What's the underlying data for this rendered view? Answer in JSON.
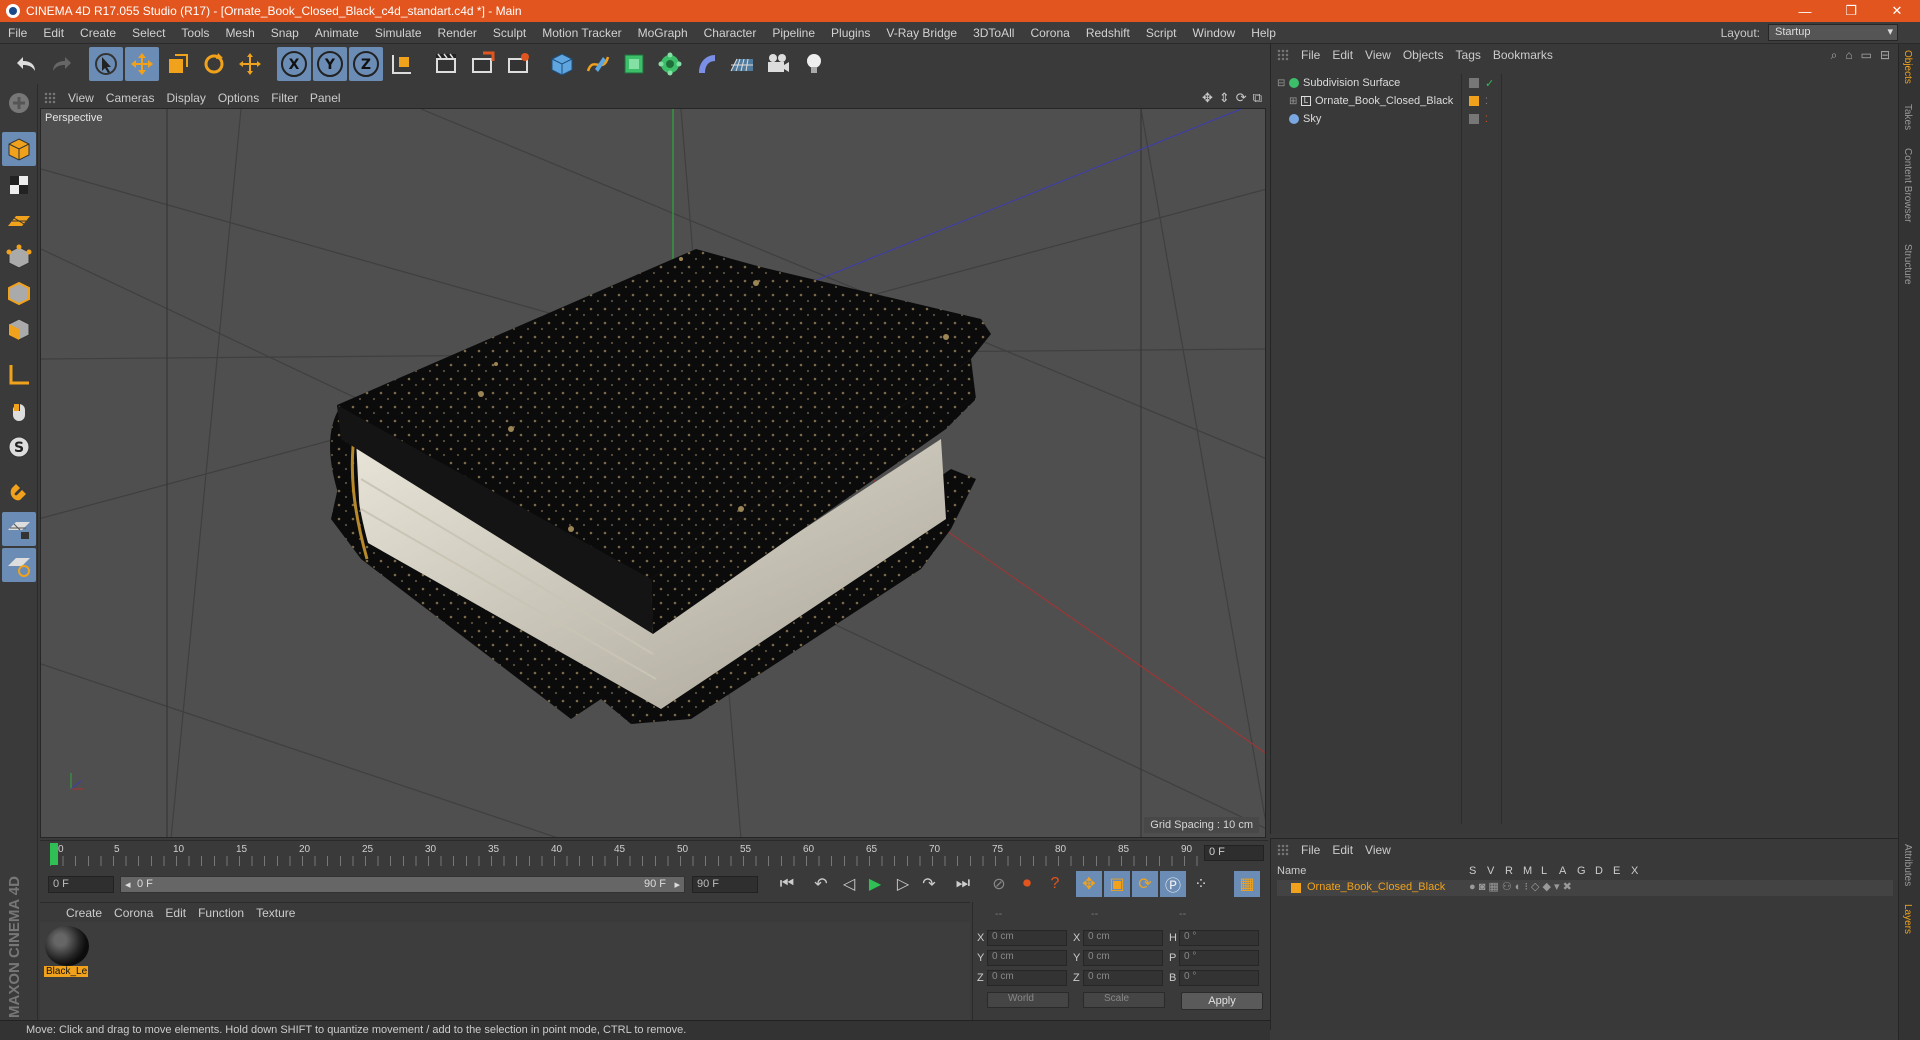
{
  "window": {
    "title": "CINEMA 4D R17.055 Studio (R17) - [Ornate_Book_Closed_Black_c4d_standart.c4d *] - Main",
    "controls": [
      "—",
      "❐",
      "✕"
    ]
  },
  "menubar": {
    "items": [
      "File",
      "Edit",
      "Create",
      "Select",
      "Tools",
      "Mesh",
      "Snap",
      "Animate",
      "Simulate",
      "Render",
      "Sculpt",
      "Motion Tracker",
      "MoGraph",
      "Character",
      "Pipeline",
      "Plugins",
      "V-Ray Bridge",
      "3DToAll",
      "Corona",
      "Redshift",
      "Script",
      "Window",
      "Help"
    ],
    "layout_label": "Layout:",
    "layout_value": "Startup"
  },
  "toolbar": {
    "axis_x": "X",
    "axis_y": "Y",
    "axis_z": "Z"
  },
  "viewport": {
    "menu": [
      "View",
      "Cameras",
      "Display",
      "Options",
      "Filter",
      "Panel"
    ],
    "label": "Perspective",
    "grid_spacing": "Grid Spacing : 10 cm"
  },
  "timeline": {
    "ticks": [
      "0",
      "5",
      "10",
      "15",
      "20",
      "25",
      "30",
      "35",
      "40",
      "45",
      "50",
      "55",
      "60",
      "65",
      "70",
      "75",
      "80",
      "85",
      "90"
    ],
    "current_frame": "0 F"
  },
  "transport": {
    "start": "0 F",
    "range_start": "0 F",
    "range_end": "90 F",
    "end": "90 F"
  },
  "material_manager": {
    "menu": [
      "Create",
      "Corona",
      "Edit",
      "Function",
      "Texture"
    ],
    "material_name": "Black_Le"
  },
  "coordinates": {
    "headers": [
      "--",
      "--",
      "--"
    ],
    "pos_labels": [
      "X",
      "Y",
      "Z"
    ],
    "pos_values": [
      "0 cm",
      "0 cm",
      "0 cm"
    ],
    "size_labels": [
      "X",
      "Y",
      "Z"
    ],
    "size_values": [
      "0 cm",
      "0 cm",
      "0 cm"
    ],
    "rot_labels": [
      "H",
      "P",
      "B"
    ],
    "rot_values": [
      "0 °",
      "0 °",
      "0 °"
    ],
    "mode": "World",
    "scale": "Scale",
    "apply": "Apply"
  },
  "status": "Move: Click and drag to move elements. Hold down SHIFT to quantize movement / add to the selection in point mode, CTRL to remove.",
  "object_manager": {
    "menu": [
      "File",
      "Edit",
      "View",
      "Objects",
      "Tags",
      "Bookmarks"
    ],
    "objects": [
      {
        "name": "Subdivision Surface",
        "tag_color": "#8a8a8a"
      },
      {
        "name": "Ornate_Book_Closed_Black",
        "tag_color": "#f0a21c"
      },
      {
        "name": "Sky",
        "tag_color": "#8a8a8a"
      }
    ]
  },
  "layer_manager": {
    "menu": [
      "File",
      "Edit",
      "View"
    ],
    "columns": [
      "Name",
      "S",
      "V",
      "R",
      "M",
      "L",
      "A",
      "G",
      "D",
      "E",
      "X"
    ],
    "layer_name": "Ornate_Book_Closed_Black"
  },
  "side_tabs": [
    "Objects",
    "Takes",
    "Content Browser",
    "Structure",
    "Attributes",
    "Layers"
  ],
  "branding": {
    "logo": "MAXON CINEMA 4D"
  },
  "colors": {
    "accent": "#e2551f",
    "highlight": "#6b8db5",
    "layer": "#f0a21c"
  }
}
